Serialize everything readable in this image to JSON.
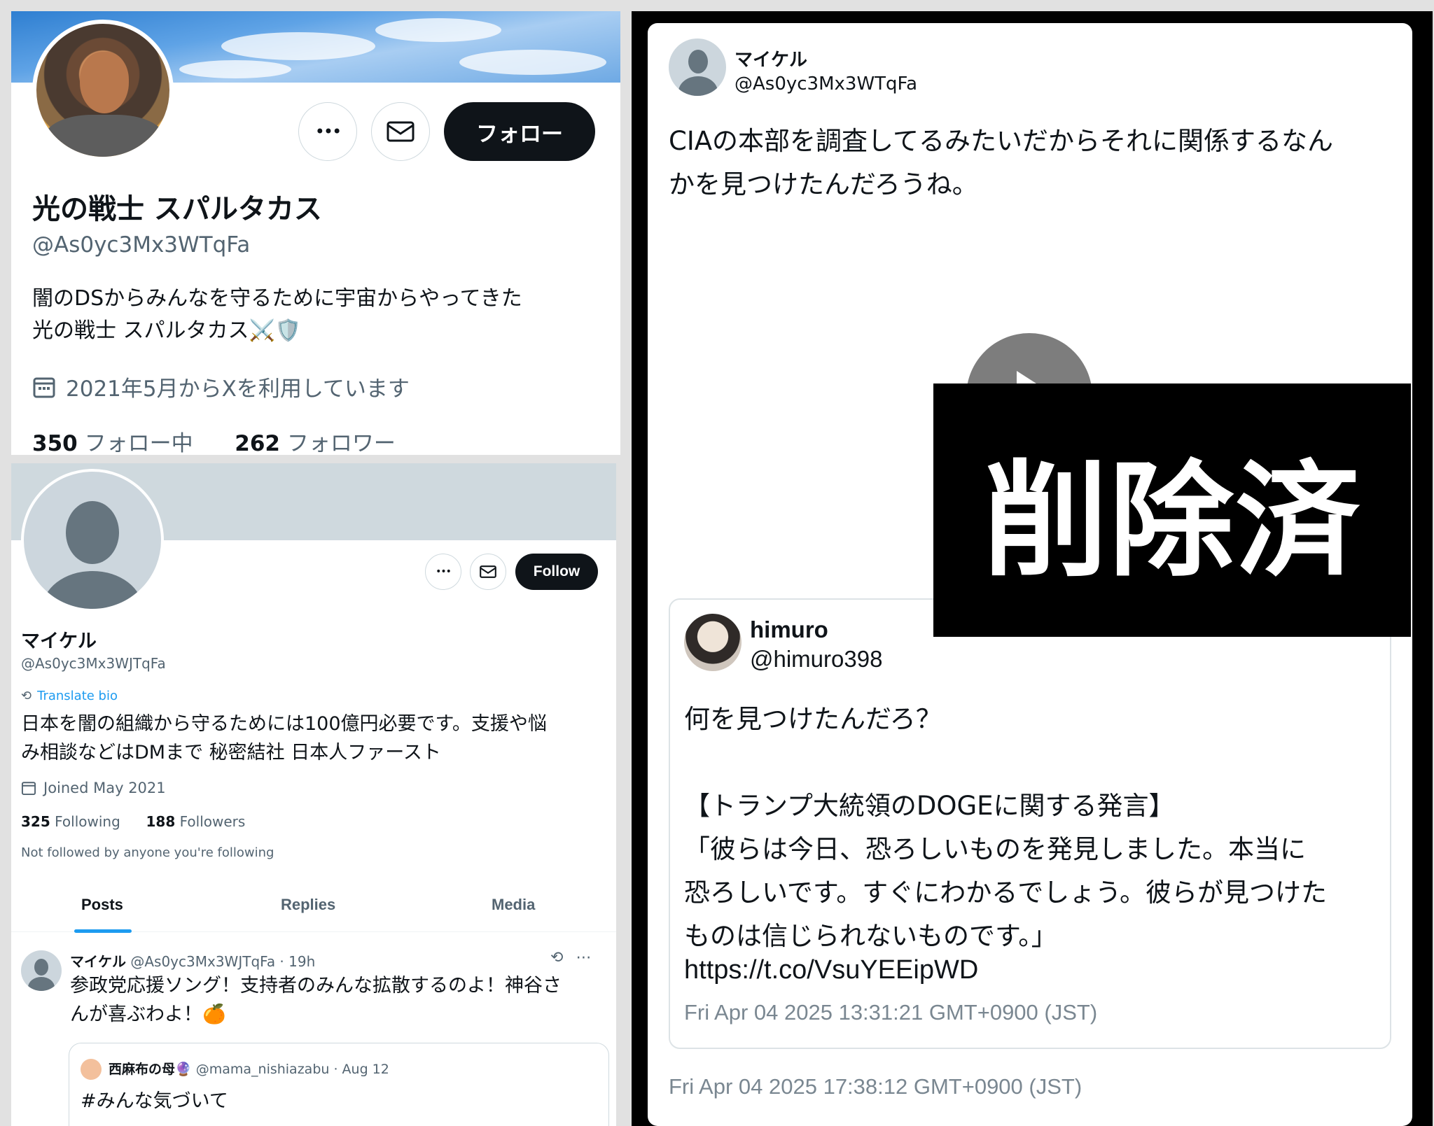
{
  "panel1": {
    "name": "光の戦士 スパルタカス",
    "handle": "@As0yc3Mx3WTqFa",
    "bio_line1": "闇のDSからみんなを守るために宇宙からやってきた",
    "bio_line2": "光の戦士 スパルタカス⚔️🛡️",
    "joined": "2021年5月からXを利用しています",
    "following_count": "350",
    "following_label": "フォロー中",
    "followers_count": "262",
    "followers_label": "フォロワー",
    "follow_label": "フォロー",
    "more_icon": "•••",
    "mail_icon": "✉"
  },
  "panel2": {
    "name": "マイケル",
    "handle": "@As0yc3Mx3WJTqFa",
    "translate": "Translate bio",
    "bio_line1": "日本を闇の組織から守るためには100億円必要です。支援や悩",
    "bio_line2": "み相談などはDMまで 秘密結社 日本人ファースト",
    "joined": "Joined May 2021",
    "following_count": "325",
    "following_label": "Following",
    "followers_count": "188",
    "followers_label": "Followers",
    "not_followed": "Not followed by anyone you're following",
    "follow_label": "Follow",
    "more_icon": "•••",
    "mail_icon": "✉",
    "tabs": [
      "Posts",
      "Replies",
      "Media"
    ],
    "post": {
      "author": "マイケル",
      "meta": "@As0yc3Mx3WJTqFa · 19h",
      "line1": "参政党応援ソング！支持者のみんな拡散するのよ！神谷さ",
      "line2": "んが喜ぶわよ！🍊",
      "quote_author": "西麻布の母🔮",
      "quote_meta": "@mama_nishiazabu · Aug 12",
      "quote_text": "#みんな気づいて"
    }
  },
  "right": {
    "name": "マイケル",
    "handle": "@As0yc3Mx3WTqFa",
    "text_line1": "CIAの本部を調査してるみたいだからそれに関係するなん",
    "text_line2": "かを見つけたんだろうね。",
    "quote": {
      "name": "himuro",
      "handle": "@himuro398",
      "text": "何を見つけたんだろ？\n\n【トランプ大統領のDOGEに関する発言】\n「彼らは今日、恐ろしいものを発見しました。本当に\n恐ろしいです。すぐにわかるでしょう。彼らが見つけた\nものは信じられないものです。」",
      "link": "https://t.co/VsuYEEipWD",
      "time": "Fri Apr 04 2025 13:31:21 GMT+0900 (JST)"
    },
    "time": "Fri Apr 04 2025 17:38:12 GMT+0900 (JST)",
    "deleted_label": "削除済"
  }
}
